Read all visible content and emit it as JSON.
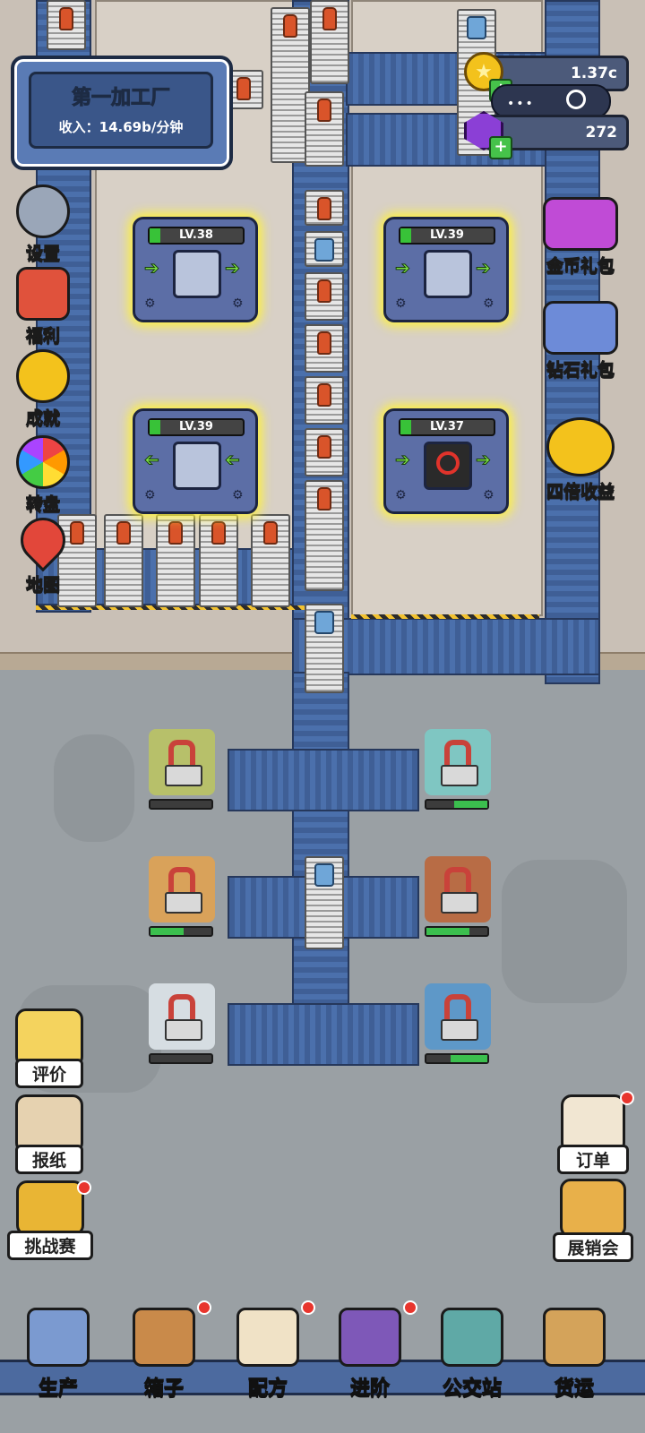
{
  "factory": {
    "name": "第一加工厂",
    "income": "收入：14.69b/分钟"
  },
  "currency": {
    "coins": "1.37c",
    "gems": "272"
  },
  "left_menu": [
    {
      "label": "设置",
      "icon": "gear-icon"
    },
    {
      "label": "福利",
      "icon": "gift-icon"
    },
    {
      "label": "成就",
      "icon": "star-badge-icon"
    },
    {
      "label": "转盘",
      "icon": "wheel-icon"
    },
    {
      "label": "地图",
      "icon": "map-pin-icon"
    }
  ],
  "right_menu": [
    {
      "label": "金币礼包",
      "icon": "coin-chest-icon"
    },
    {
      "label": "钻石礼包",
      "icon": "gem-chest-icon"
    },
    {
      "label": "四倍收益",
      "icon": "coin-stack-icon"
    }
  ],
  "machines": [
    {
      "level": "LV.38",
      "state": "running"
    },
    {
      "level": "LV.39",
      "state": "running"
    },
    {
      "level": "LV.39",
      "state": "running"
    },
    {
      "level": "LV.37",
      "state": "stopped"
    }
  ],
  "stations": [
    {
      "color": "#b7c06a",
      "progress": 0.0
    },
    {
      "color": "#7fc6c2",
      "progress": 0.55
    },
    {
      "color": "#d9a25a",
      "progress": 0.55
    },
    {
      "color": "#b86c45",
      "progress": 0.7
    },
    {
      "color": "#d6dde2",
      "progress": 0.0
    },
    {
      "color": "#5e98c8",
      "progress": 0.6
    }
  ],
  "left_lower_menu": [
    {
      "label": "评价",
      "icon": "thumbs-up-icon"
    },
    {
      "label": "报纸",
      "icon": "newspaper-icon"
    },
    {
      "label": "挑战赛",
      "icon": "trophy-icon"
    }
  ],
  "right_lower_menu": [
    {
      "label": "订单",
      "icon": "clipboard-icon"
    },
    {
      "label": "展销会",
      "icon": "billboard-icon"
    }
  ],
  "bottom_nav": [
    {
      "label": "生产",
      "icon": "robot-arm-icon"
    },
    {
      "label": "箱子",
      "icon": "crate-icon"
    },
    {
      "label": "配方",
      "icon": "recipe-book-icon"
    },
    {
      "label": "进阶",
      "icon": "upgrade-icon"
    },
    {
      "label": "公交站",
      "icon": "bus-stop-icon"
    },
    {
      "label": "货运",
      "icon": "cargo-icon"
    }
  ]
}
